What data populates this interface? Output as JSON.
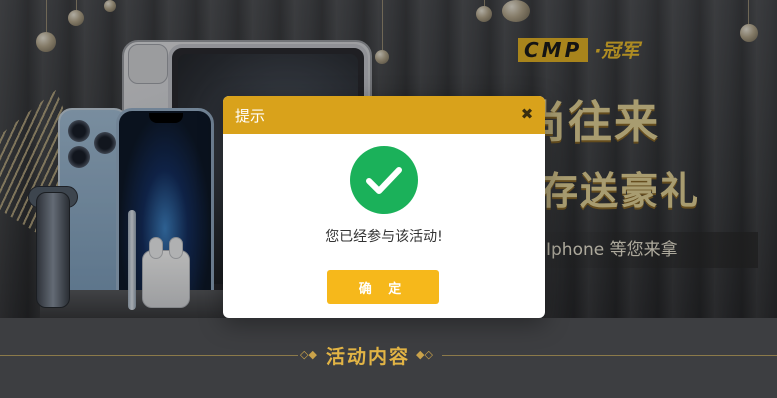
{
  "banner": {
    "brand_logo": "CMP",
    "brand_name": "·冠军",
    "headline_line1": "时尚往来",
    "headline_line2": "存送豪礼",
    "subline": "Iphone 等您来拿"
  },
  "section": {
    "title": "活动内容"
  },
  "modal": {
    "title": "提示",
    "close_icon": "close-icon",
    "status_icon": "success-check-icon",
    "message": "您已经参与该活动!",
    "confirm_label": "确 定"
  },
  "colors": {
    "header_bg": "#d9a21b",
    "button_bg": "#f6b81b",
    "success_green": "#1bb15a",
    "section_title": "#e2b445"
  }
}
